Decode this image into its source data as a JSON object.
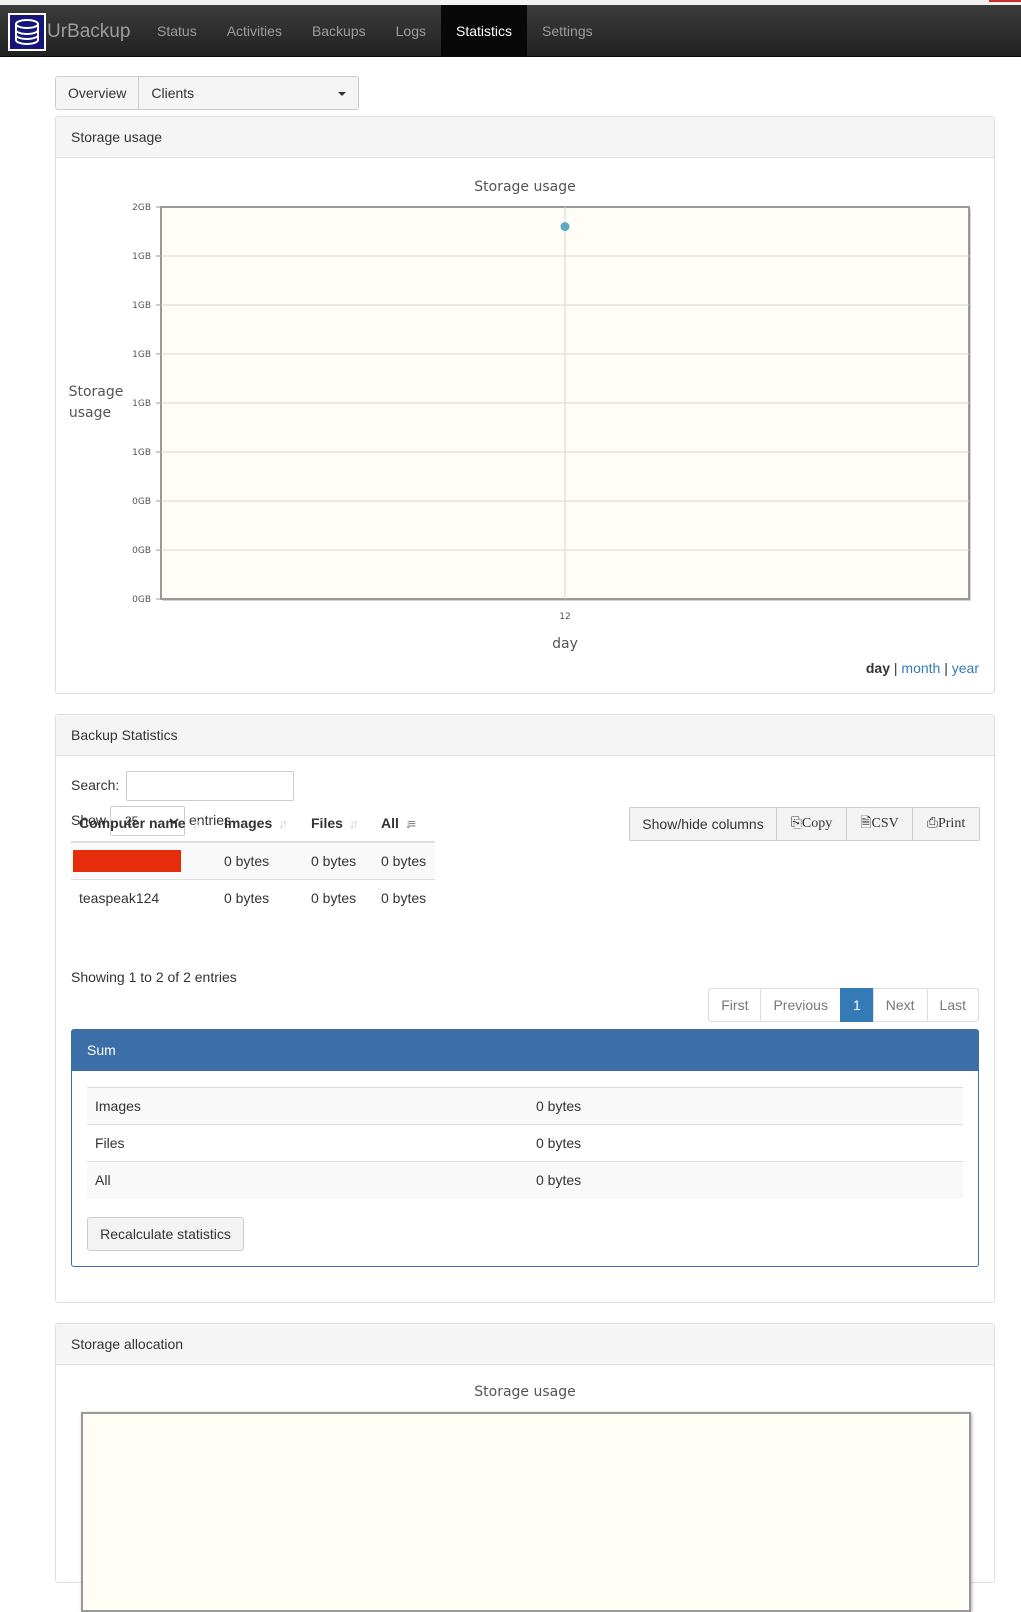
{
  "brand": {
    "name": "UrBackup"
  },
  "nav": {
    "items": [
      "Status",
      "Activities",
      "Backups",
      "Logs",
      "Statistics",
      "Settings"
    ],
    "active": "Statistics"
  },
  "tabs": {
    "overview": "Overview",
    "clients_selected": "Clients"
  },
  "storage_usage_panel": {
    "heading": "Storage usage",
    "ranges": {
      "day": "day",
      "month": "month",
      "year": "year",
      "separator": "|",
      "active": "day"
    }
  },
  "chart_data": {
    "type": "scatter",
    "title": "Storage usage",
    "xlabel": "day",
    "ylabel": "Storage usage",
    "x_ticks": [
      "12"
    ],
    "y_ticks": [
      "2GB",
      "1GB",
      "1GB",
      "1GB",
      "1GB",
      "1GB",
      "0GB",
      "0GB",
      "0GB"
    ],
    "ylim": [
      0,
      2
    ],
    "grid": true,
    "series": [
      {
        "x": [
          "12"
        ],
        "values": [
          1.9
        ]
      }
    ],
    "colors": {
      "point": "#5fa8c4",
      "plot_background": "#fffdf6"
    }
  },
  "backup_statistics": {
    "heading": "Backup Statistics",
    "search_label": "Search:",
    "show_label": "Show",
    "entries_label": "entries",
    "page_length": "25",
    "buttons": {
      "columns": "Show/hide columns",
      "copy": "Copy",
      "csv": "CSV",
      "print": "Print"
    },
    "columns": [
      "Computer name",
      "Images",
      "Files",
      "All"
    ],
    "rows": [
      {
        "name": "",
        "images": "0 bytes",
        "files": "0 bytes",
        "all": "0 bytes"
      },
      {
        "name": "teaspeak124",
        "images": "0 bytes",
        "files": "0 bytes",
        "all": "0 bytes"
      }
    ],
    "info": "Showing 1 to 2 of 2 entries",
    "pagination": {
      "first": "First",
      "previous": "Previous",
      "current": "1",
      "next": "Next",
      "last": "Last"
    }
  },
  "sum": {
    "heading": "Sum",
    "rows": [
      {
        "label": "Images",
        "value": "0 bytes"
      },
      {
        "label": "Files",
        "value": "0 bytes"
      },
      {
        "label": "All",
        "value": "0 bytes"
      }
    ],
    "recalc_button": "Recalculate statistics"
  },
  "storage_allocation": {
    "heading": "Storage allocation",
    "chart_title": "Storage usage"
  }
}
